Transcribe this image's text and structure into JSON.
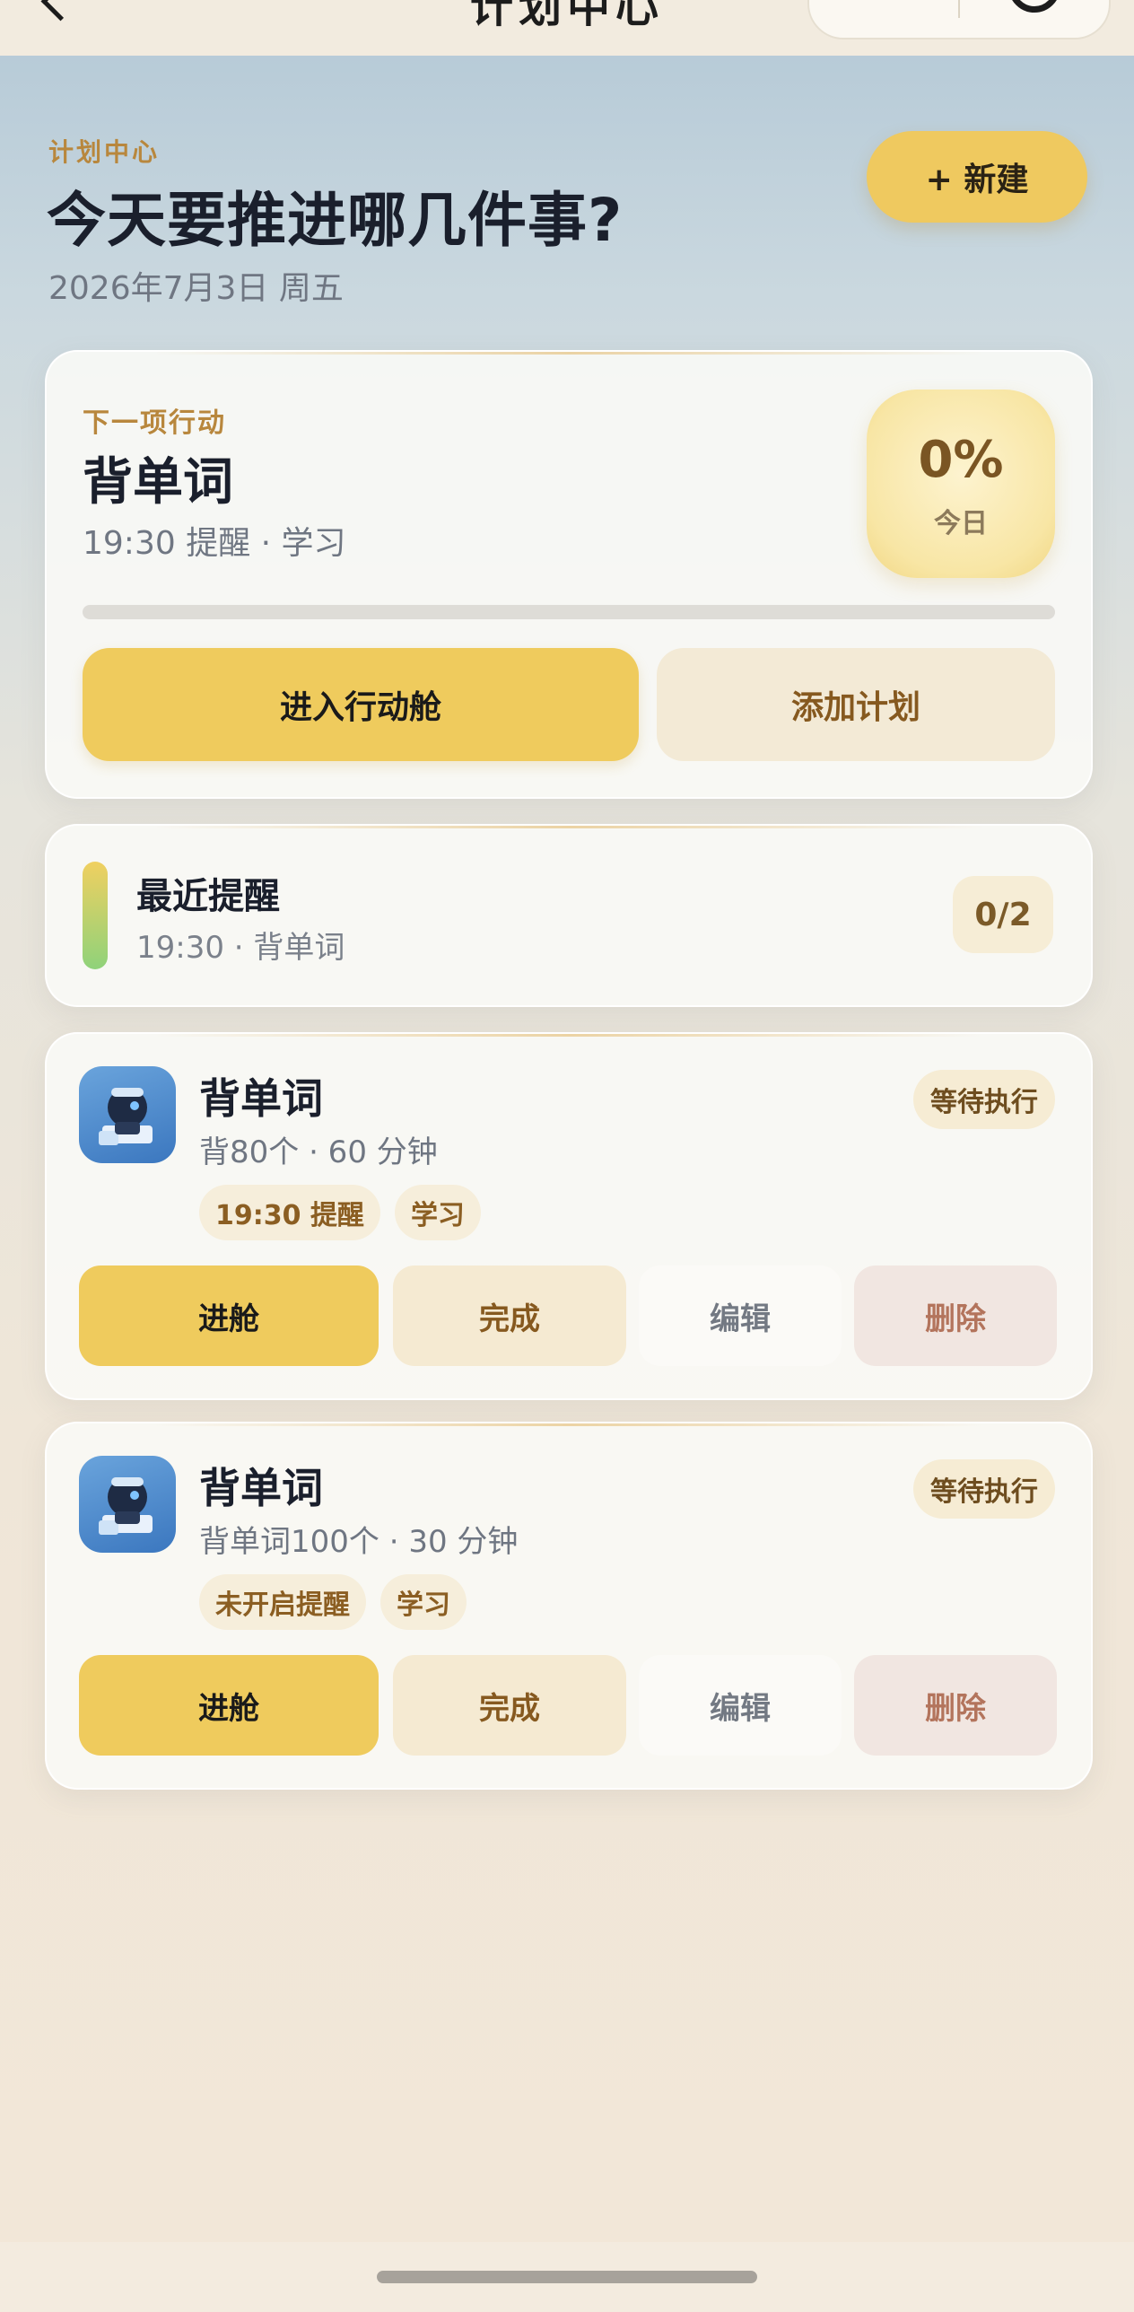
{
  "nav": {
    "title": "计划中心"
  },
  "header": {
    "eyebrow": "计划中心",
    "headline": "今天要推进哪几件事?",
    "date": "2026年7月3日 周五",
    "new_button": "+ 新建"
  },
  "next_action": {
    "label": "下一项行动",
    "title": "背单词",
    "meta": "19:30 提醒 · 学习",
    "percent": "0%",
    "percent_label": "今日",
    "progress_fraction": 0,
    "primary_button": "进入行动舱",
    "secondary_button": "添加计划"
  },
  "reminder": {
    "title": "最近提醒",
    "meta": "19:30 · 背单词",
    "count": "0/2"
  },
  "plans": [
    {
      "title": "背单词",
      "meta": "背80个 · 60 分钟",
      "status": "等待执行",
      "tags": [
        "19:30 提醒",
        "学习"
      ],
      "icon": "robot-avatar-icon",
      "actions": {
        "enter": "进舱",
        "done": "完成",
        "edit": "编辑",
        "delete": "删除"
      }
    },
    {
      "title": "背单词",
      "meta": "背单词100个 · 30 分钟",
      "status": "等待执行",
      "tags": [
        "未开启提醒",
        "学习"
      ],
      "icon": "robot-avatar-icon",
      "actions": {
        "enter": "进舱",
        "done": "完成",
        "edit": "编辑",
        "delete": "删除"
      }
    }
  ],
  "colors": {
    "accent": "#efcb5d",
    "eyebrow": "#b8873d",
    "danger_text": "#b3745c"
  }
}
